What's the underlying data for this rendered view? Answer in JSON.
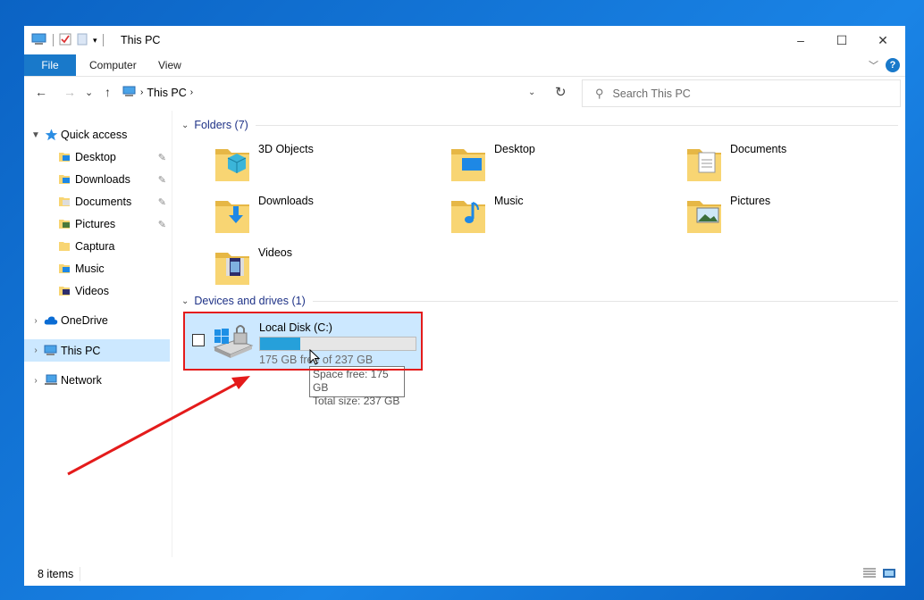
{
  "window": {
    "title": "This PC",
    "minimize_glyph": "–",
    "maximize_glyph": "☐",
    "close_glyph": "✕"
  },
  "ribbon": {
    "tabs": [
      "File",
      "Computer",
      "View"
    ],
    "help_glyph": "?"
  },
  "address": {
    "back_glyph": "←",
    "forward_glyph": "→",
    "recent_glyph": "⌄",
    "up_glyph": "↑",
    "breadcrumb": "This PC",
    "refresh_glyph": "↻",
    "search_placeholder": "Search This PC"
  },
  "navpane": {
    "quick_access": "Quick access",
    "quick_items": [
      {
        "label": "Desktop",
        "pinned": true,
        "icon": "desktop-folder-icon"
      },
      {
        "label": "Downloads",
        "pinned": true,
        "icon": "downloads-folder-icon"
      },
      {
        "label": "Documents",
        "pinned": true,
        "icon": "documents-folder-icon"
      },
      {
        "label": "Pictures",
        "pinned": true,
        "icon": "pictures-folder-icon"
      },
      {
        "label": "Captura",
        "pinned": false,
        "icon": "folder-icon"
      },
      {
        "label": "Music",
        "pinned": false,
        "icon": "music-folder-icon"
      },
      {
        "label": "Videos",
        "pinned": false,
        "icon": "videos-folder-icon"
      }
    ],
    "onedrive": "OneDrive",
    "this_pc": "This PC",
    "network": "Network",
    "pin_glyph": "📌"
  },
  "content": {
    "folders_header": "Folders (7)",
    "folders": [
      {
        "label": "3D Objects",
        "icon": "3d-objects-folder-icon"
      },
      {
        "label": "Desktop",
        "icon": "desktop-folder-icon"
      },
      {
        "label": "Documents",
        "icon": "documents-folder-icon"
      },
      {
        "label": "Downloads",
        "icon": "downloads-folder-icon"
      },
      {
        "label": "Music",
        "icon": "music-folder-icon"
      },
      {
        "label": "Pictures",
        "icon": "pictures-folder-icon"
      },
      {
        "label": "Videos",
        "icon": "videos-folder-icon"
      }
    ],
    "drives_header": "Devices and drives (1)",
    "drive": {
      "name": "Local Disk (C:)",
      "free_text": "175 GB free of 237 GB",
      "used_fraction": 0.26
    },
    "tooltip": {
      "line1": "Space free: 175 GB",
      "line2": "Total size: 237 GB"
    }
  },
  "status": {
    "items": "8 items"
  },
  "annotation": {
    "color": "#e41b1b"
  }
}
